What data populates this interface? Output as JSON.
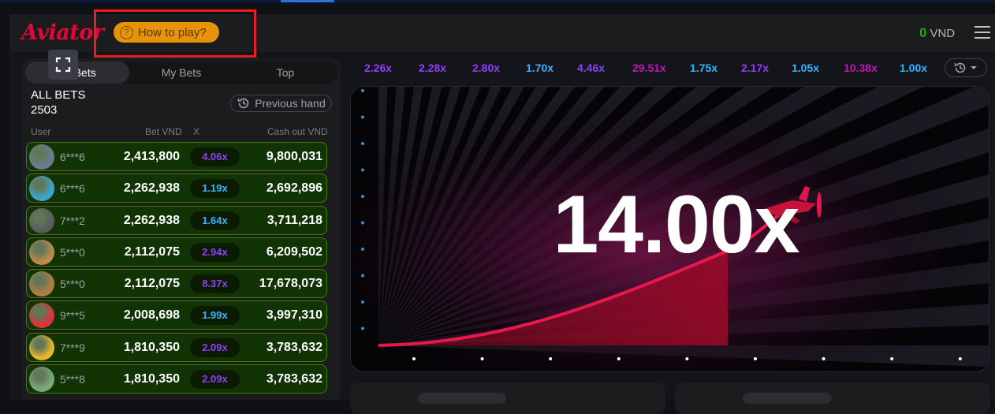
{
  "header": {
    "logo": "Aviator",
    "how_to_play": "How to play?",
    "balance_amount": "0",
    "balance_currency": "VND"
  },
  "bets_panel": {
    "tabs": [
      {
        "label": "All Bets",
        "active": true
      },
      {
        "label": "My Bets",
        "active": false
      },
      {
        "label": "Top",
        "active": false
      }
    ],
    "title": "ALL BETS",
    "count": "2503",
    "previous_hand": "Previous hand",
    "columns": {
      "user": "User",
      "bet": "Bet VND",
      "x": "X",
      "cashout": "Cash out VND"
    },
    "rows": [
      {
        "user": "6***6",
        "bet": "2,413,800",
        "mult": "4.06x",
        "mult_color": "#913ef8",
        "cashout": "9,800,031",
        "avatar_color": "#6b7a8c"
      },
      {
        "user": "6***6",
        "bet": "2,262,938",
        "mult": "1.19x",
        "mult_color": "#34b4ff",
        "cashout": "2,692,896",
        "avatar_color": "#3aa6c9"
      },
      {
        "user": "7***2",
        "bet": "2,262,938",
        "mult": "1.64x",
        "mult_color": "#34b4ff",
        "cashout": "3,711,218",
        "avatar_color": "#5a5a5a"
      },
      {
        "user": "5***0",
        "bet": "2,112,075",
        "mult": "2.94x",
        "mult_color": "#913ef8",
        "cashout": "6,209,502",
        "avatar_color": "#c08a4a"
      },
      {
        "user": "5***0",
        "bet": "2,112,075",
        "mult": "8.37x",
        "mult_color": "#913ef8",
        "cashout": "17,678,073",
        "avatar_color": "#b07d45"
      },
      {
        "user": "9***5",
        "bet": "2,008,698",
        "mult": "1.99x",
        "mult_color": "#34b4ff",
        "cashout": "3,997,310",
        "avatar_color": "#d8343a"
      },
      {
        "user": "7***9",
        "bet": "1,810,350",
        "mult": "2.09x",
        "mult_color": "#913ef8",
        "cashout": "3,783,632",
        "avatar_color": "#e8b62a"
      },
      {
        "user": "5***8",
        "bet": "1,810,350",
        "mult": "2.09x",
        "mult_color": "#913ef8",
        "cashout": "3,783,632",
        "avatar_color": "#7aa87a"
      }
    ]
  },
  "history": [
    {
      "value": "2.26x",
      "color": "#913ef8"
    },
    {
      "value": "2.28x",
      "color": "#913ef8"
    },
    {
      "value": "2.80x",
      "color": "#913ef8"
    },
    {
      "value": "1.70x",
      "color": "#34b4ff"
    },
    {
      "value": "4.46x",
      "color": "#913ef8"
    },
    {
      "value": "29.51x",
      "color": "#c017b4"
    },
    {
      "value": "1.75x",
      "color": "#34b4ff"
    },
    {
      "value": "2.17x",
      "color": "#913ef8"
    },
    {
      "value": "1.05x",
      "color": "#34b4ff"
    },
    {
      "value": "10.38x",
      "color": "#c017b4"
    },
    {
      "value": "1.00x",
      "color": "#34b4ff"
    }
  ],
  "game": {
    "multiplier": "14.00x"
  }
}
